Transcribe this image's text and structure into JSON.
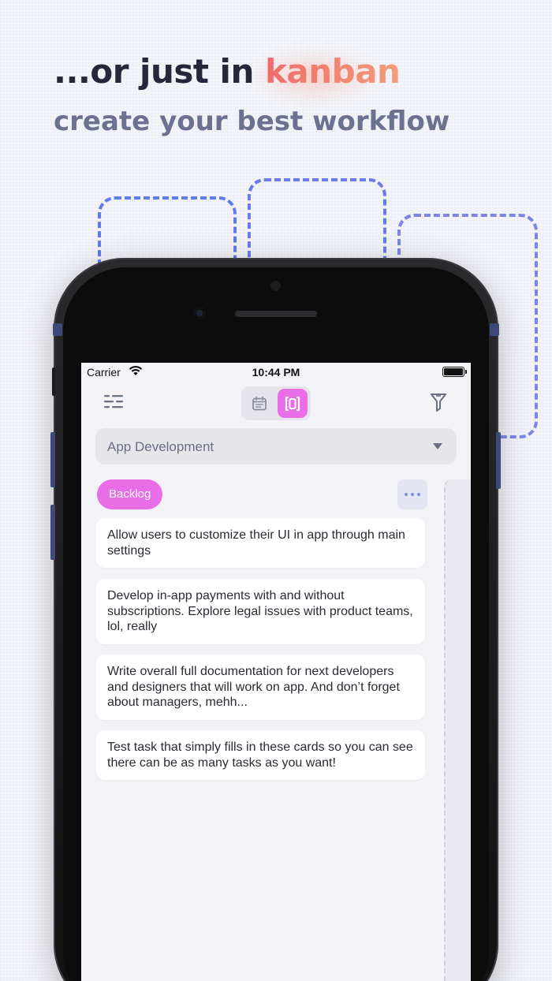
{
  "hero": {
    "headline_prefix": "...or just in ",
    "headline_accent": "kanban",
    "subline": "create your best workflow"
  },
  "colors": {
    "accent_pink": "#e86de6",
    "accent_blue": "#5f7ce8",
    "headline_gradient": [
      "#ef6b6b",
      "#f59d77"
    ]
  },
  "statusbar": {
    "carrier": "Carrier",
    "time": "10:44 PM",
    "icons": [
      "wifi-icon",
      "battery-icon"
    ]
  },
  "toolbar": {
    "icons": [
      "menu-icon",
      "calendar-view-icon",
      "kanban-view-icon",
      "filter-icon"
    ],
    "active_view": "kanban"
  },
  "project_select": {
    "value": "App Development"
  },
  "column": {
    "title": "Backlog",
    "cards": [
      {
        "text": "Allow users to customize their UI in app through main settings"
      },
      {
        "text": "Develop in-app payments with and without subscriptions. Explore legal issues with product teams, lol, really"
      },
      {
        "text": "Write overall full documentation for next developers and designers that will work on app. And don’t forget about managers, mehh..."
      },
      {
        "text": "Test task that simply fills in these cards so you can see there can be as many tasks as you want!"
      }
    ]
  }
}
